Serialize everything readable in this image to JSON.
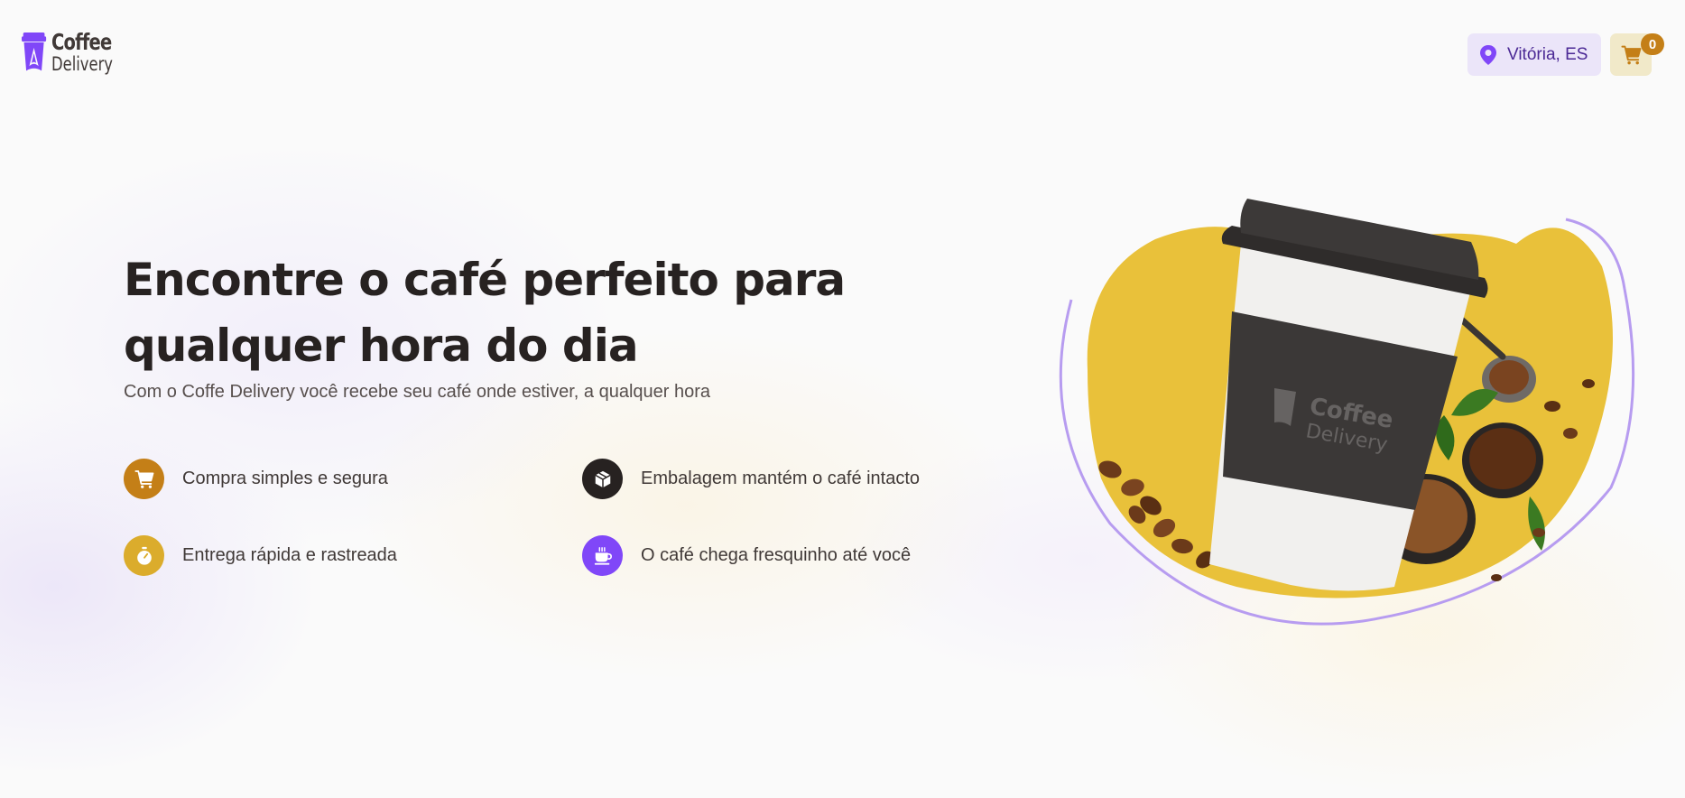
{
  "header": {
    "logo": {
      "line1": "Coffee",
      "line2": "Delivery"
    },
    "location": {
      "label": "Vitória, ES",
      "icon": "map-pin-icon"
    },
    "cart": {
      "icon": "shopping-cart-icon",
      "count": "0"
    }
  },
  "hero": {
    "title": "Encontre o café perfeito para qualquer hora do dia",
    "subtitle": "Com o Coffe Delivery você recebe seu café onde estiver, a qualquer hora",
    "features": [
      {
        "label": "Compra simples e segura",
        "icon": "shopping-cart-icon",
        "color": "#c47f17"
      },
      {
        "label": "Embalagem mantém o café intacto",
        "icon": "package-icon",
        "color": "#272221"
      },
      {
        "label": "Entrega rápida e rastreada",
        "icon": "timer-icon",
        "color": "#dbac2c"
      },
      {
        "label": "O café chega fresquinho até você",
        "icon": "coffee-icon",
        "color": "#8047f8"
      }
    ],
    "image": {
      "cup_logo_line1": "Coffee",
      "cup_logo_line2": "Delivery"
    }
  },
  "colors": {
    "purple": "#8047f8",
    "purple_dark": "#4b2995",
    "purple_light": "#ebe5f9",
    "yellow": "#dbac2c",
    "yellow_dark": "#c47f17",
    "yellow_light": "#f1e9c9"
  }
}
